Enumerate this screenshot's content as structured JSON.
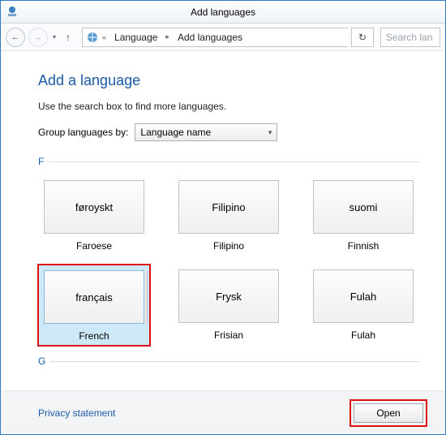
{
  "window": {
    "title": "Add languages"
  },
  "breadcrumb": {
    "item1": "Language",
    "item2": "Add languages"
  },
  "toolbar": {
    "refresh_icon": "↻",
    "back_icon": "←",
    "forward_icon": "→",
    "up_icon": "↑"
  },
  "search": {
    "placeholder": "Search lan"
  },
  "page": {
    "title": "Add a language",
    "subtext": "Use the search box to find more languages.",
    "group_label": "Group languages by:",
    "group_value": "Language name"
  },
  "groups": [
    {
      "letter": "F",
      "tiles": [
        {
          "native": "føroyskt",
          "label": "Faroese",
          "selected": false,
          "multi": false
        },
        {
          "native": "Filipino",
          "label": "Filipino",
          "selected": false,
          "multi": false
        },
        {
          "native": "suomi",
          "label": "Finnish",
          "selected": false,
          "multi": false
        },
        {
          "native": "français",
          "label": "French",
          "selected": true,
          "multi": true
        },
        {
          "native": "Frysk",
          "label": "Frisian",
          "selected": false,
          "multi": false
        },
        {
          "native": "Fulah",
          "label": "Fulah",
          "selected": false,
          "multi": false
        }
      ]
    },
    {
      "letter": "G",
      "tiles": []
    }
  ],
  "footer": {
    "privacy": "Privacy statement",
    "open": "Open"
  }
}
